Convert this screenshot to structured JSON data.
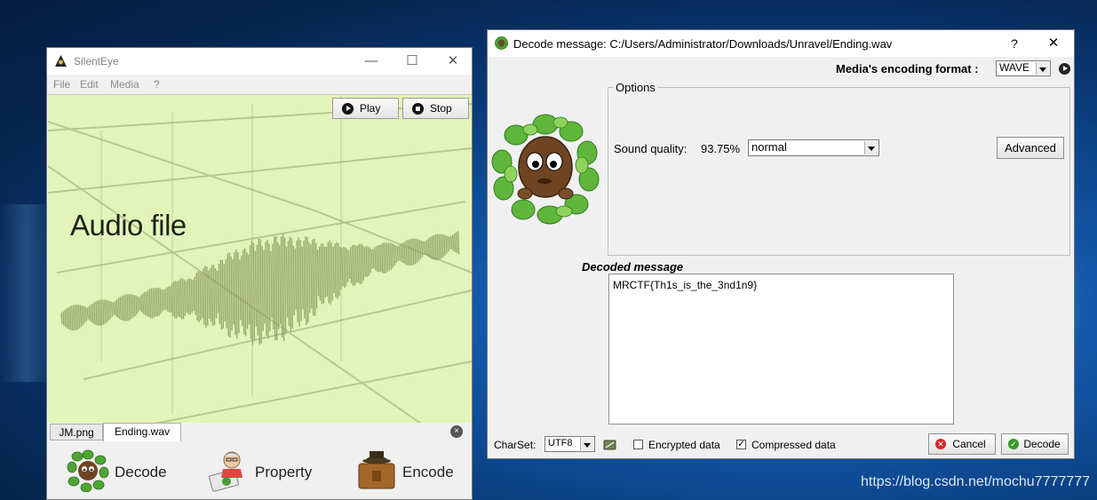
{
  "main_window": {
    "title": "SilentEye",
    "controls": {
      "minimize": "—",
      "maximize": "☐",
      "close": "✕"
    },
    "menu": [
      "File",
      "Edit",
      "Media",
      "?"
    ],
    "play_label": "Play",
    "stop_label": "Stop",
    "canvas_label": "Audio file",
    "tabs": [
      {
        "label": "JM.png",
        "active": false
      },
      {
        "label": "Ending.wav",
        "active": true
      }
    ],
    "tab_close": "×",
    "toolbar": {
      "decode_label": "Decode",
      "property_label": "Property",
      "encode_label": "Encode"
    }
  },
  "decode_dialog": {
    "title": "Decode message: C:/Users/Administrator/Downloads/Unravel/Ending.wav",
    "help": "?",
    "close": "✕",
    "encoding_format_label": "Media's encoding format :",
    "encoding_format_value": "WAVE",
    "options_title": "Options",
    "sound_quality_label": "Sound quality:",
    "sound_quality_value": "93.75%",
    "sound_quality_mode": "normal",
    "advanced_label": "Advanced",
    "decoded_message_label": "Decoded message",
    "decoded_message": "MRCTF{Th1s_is_the_3nd1n9}",
    "charset_label": "CharSet:",
    "charset_value": "UTF8",
    "encrypted_label": "Encrypted data",
    "encrypted_checked": false,
    "compressed_label": "Compressed data",
    "compressed_checked": true,
    "cancel_label": "Cancel",
    "decode_label": "Decode"
  },
  "watermark": "https://blog.csdn.net/mochu7777777"
}
